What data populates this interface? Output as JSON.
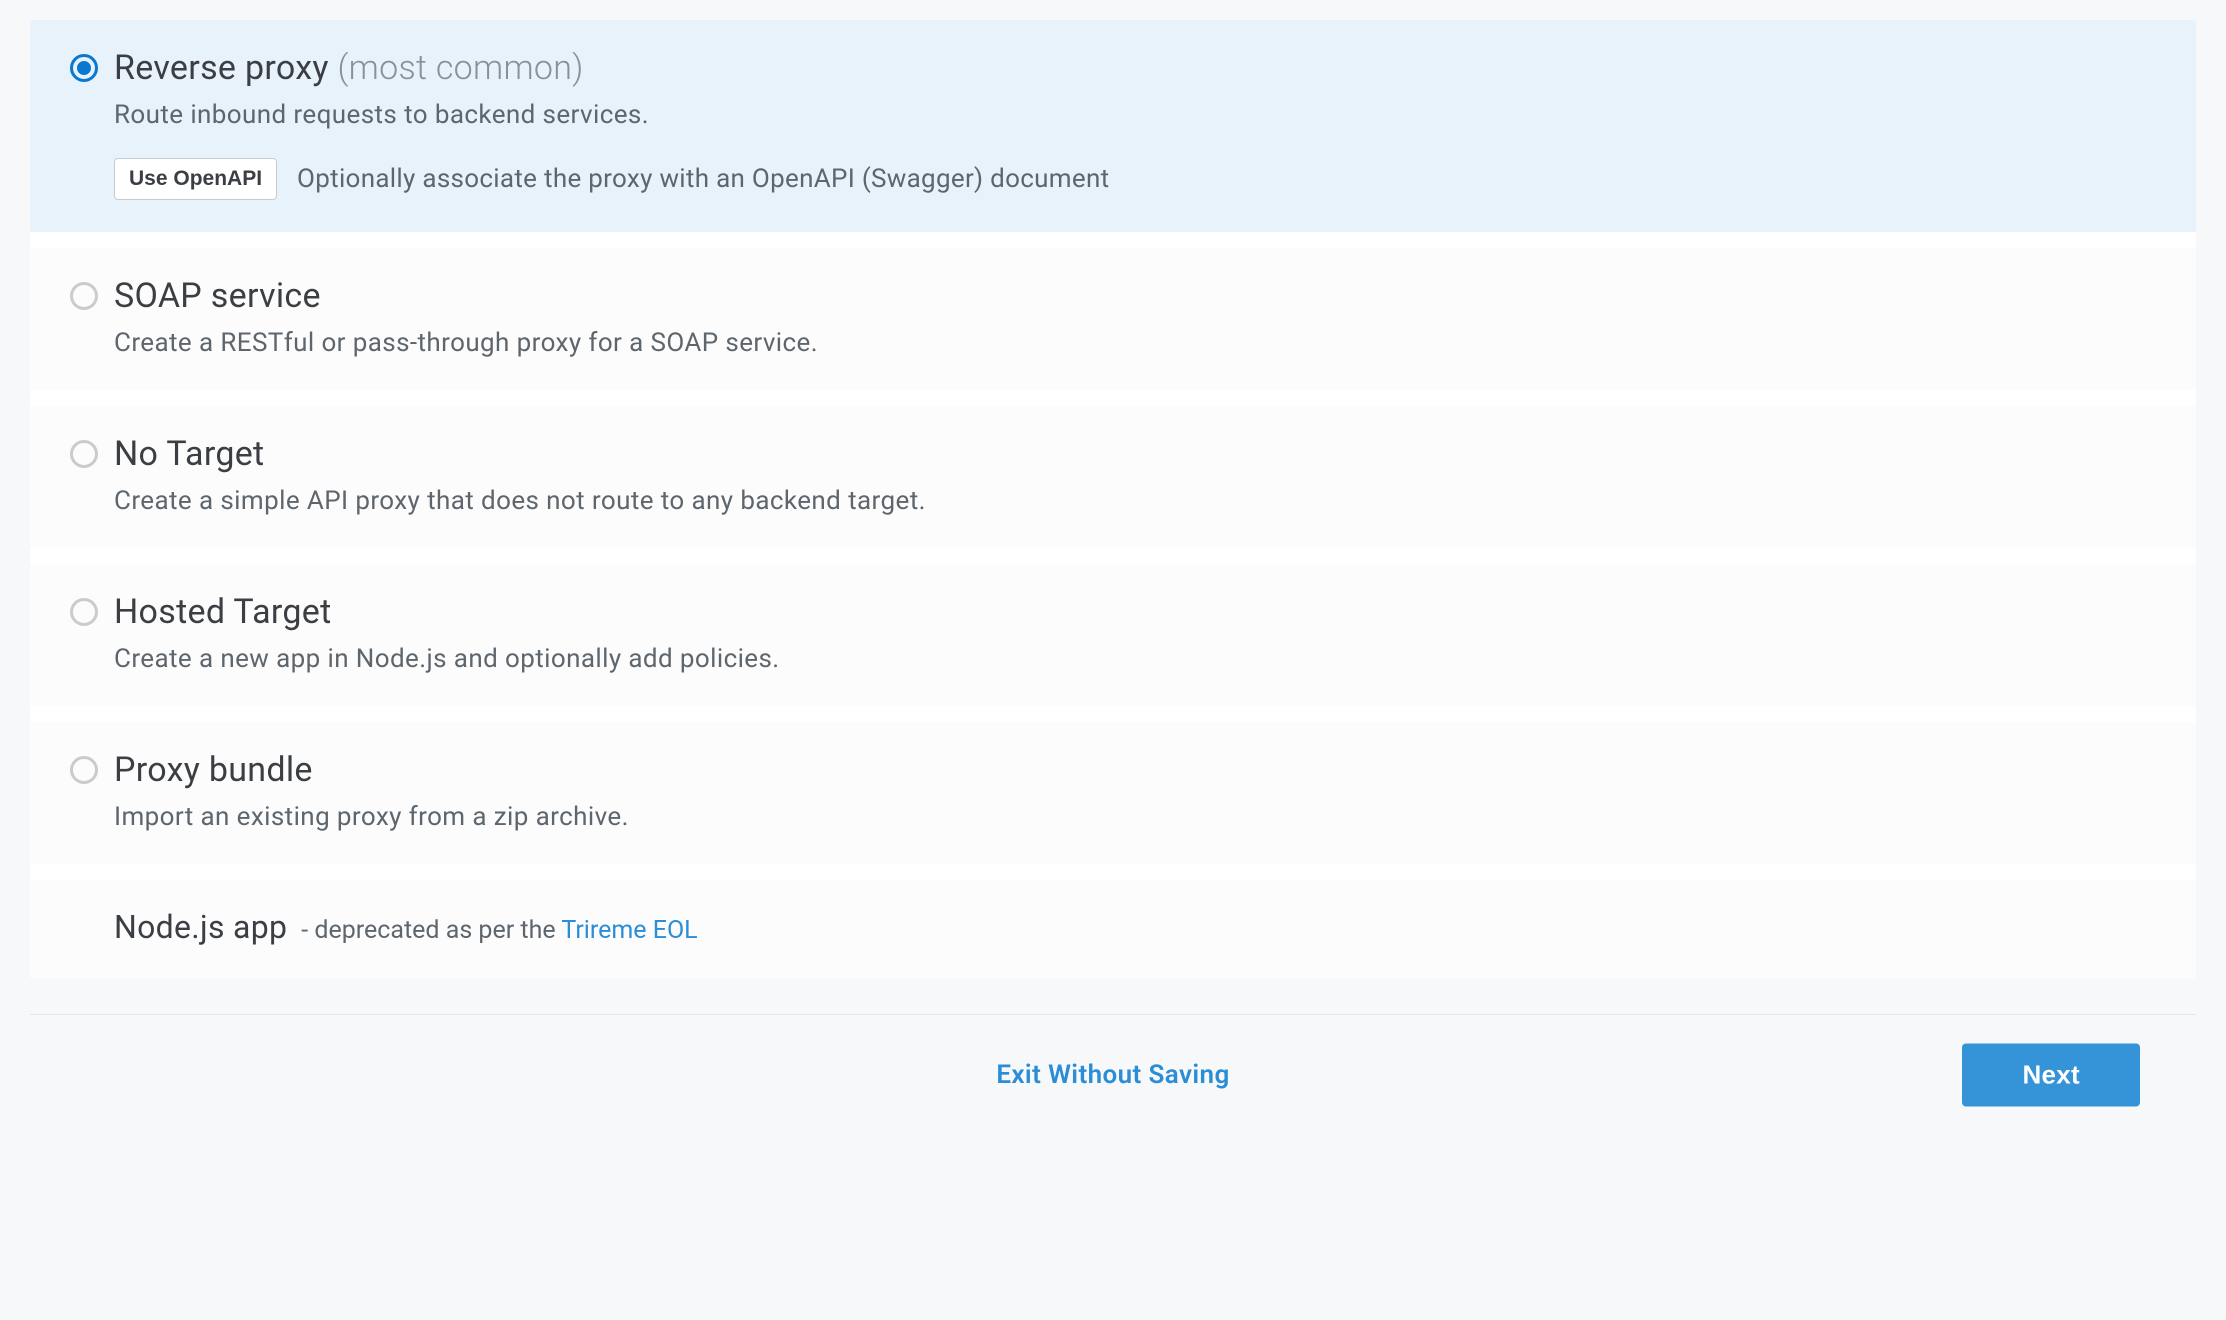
{
  "options": [
    {
      "id": "reverse-proxy",
      "title": "Reverse proxy",
      "title_suffix": "(most common)",
      "desc": "Route inbound requests to backend services.",
      "selected": true,
      "openapi_button": "Use OpenAPI",
      "openapi_hint": "Optionally associate the proxy with an OpenAPI (Swagger) document"
    },
    {
      "id": "soap-service",
      "title": "SOAP service",
      "desc": "Create a RESTful or pass-through proxy for a SOAP service.",
      "selected": false
    },
    {
      "id": "no-target",
      "title": "No Target",
      "desc": "Create a simple API proxy that does not route to any backend target.",
      "selected": false
    },
    {
      "id": "hosted-target",
      "title": "Hosted Target",
      "desc": "Create a new app in Node.js and optionally add policies.",
      "selected": false
    },
    {
      "id": "proxy-bundle",
      "title": "Proxy bundle",
      "desc": "Import an existing proxy from a zip archive.",
      "selected": false
    }
  ],
  "deprecated": {
    "title": "Node.js app",
    "note_prefix": "- deprecated as per the ",
    "link_text": "Trireme EOL"
  },
  "footer": {
    "exit": "Exit Without Saving",
    "next": "Next"
  }
}
